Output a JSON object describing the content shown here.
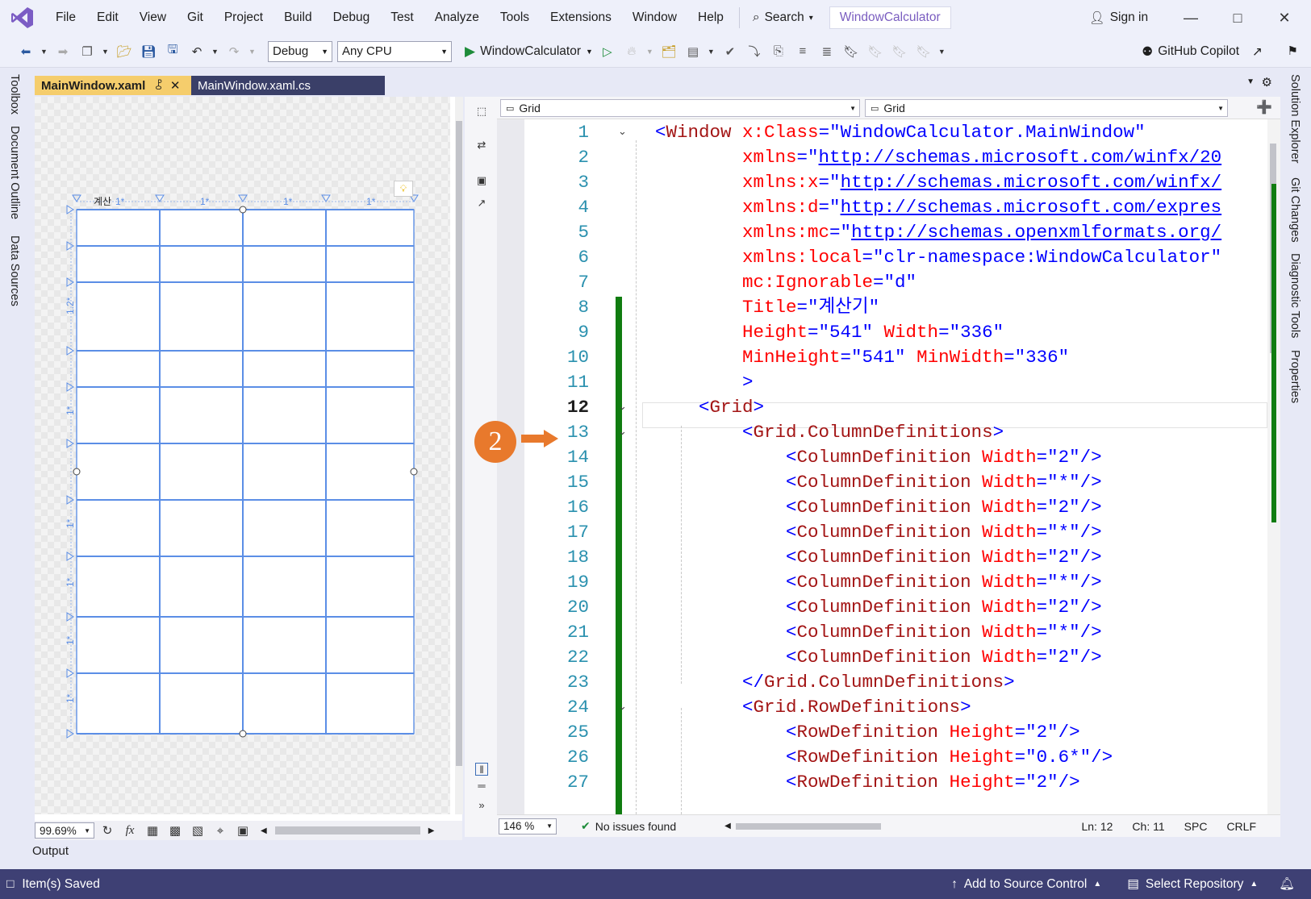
{
  "titlebar": {
    "menu": [
      "File",
      "Edit",
      "View",
      "Git",
      "Project",
      "Build",
      "Debug",
      "Test",
      "Analyze",
      "Tools",
      "Extensions",
      "Window",
      "Help"
    ],
    "search_label": "Search",
    "solution_name": "WindowCalculator",
    "signin_label": "Sign in"
  },
  "toolbar": {
    "config": "Debug",
    "platform": "Any CPU",
    "run_label": "WindowCalculator",
    "copilot_label": "GitHub Copilot"
  },
  "left_rail": [
    "Toolbox",
    "Document Outline",
    "Data Sources"
  ],
  "right_rail": [
    "Solution Explorer",
    "Git Changes",
    "Diagnostic Tools",
    "Properties"
  ],
  "tabs": [
    {
      "label": "MainWindow.xaml",
      "active": true
    },
    {
      "label": "MainWindow.xaml.cs",
      "active": false
    }
  ],
  "designer": {
    "title_fragment": "계산",
    "col_labels": [
      "1*",
      "1*",
      "1*",
      "1*"
    ],
    "row_labels": [
      "1.2*",
      "1*",
      "1*",
      "1*",
      "1*",
      "1*"
    ],
    "zoom": "99.69%"
  },
  "editor": {
    "nav_left": "Grid",
    "nav_right": "Grid",
    "zoom": "146 %",
    "issues": "No issues found",
    "line": "Ln: 12",
    "col": "Ch: 11",
    "spc": "SPC",
    "eol": "CRLF",
    "lines": [
      {
        "n": "1",
        "fold": true,
        "segs": [
          [
            "b",
            "<"
          ],
          [
            "t",
            "Window"
          ],
          [
            "a",
            " x:Class"
          ],
          [
            "b",
            "=\""
          ],
          [
            "b",
            "WindowCalculator.MainWindow"
          ],
          [
            "b",
            "\""
          ]
        ]
      },
      {
        "n": "2",
        "segs": [
          [
            "a",
            "        xmlns"
          ],
          [
            "b",
            "=\""
          ],
          [
            "u",
            "http://schemas.microsoft.com/winfx/20"
          ]
        ]
      },
      {
        "n": "3",
        "segs": [
          [
            "a",
            "        xmlns:x"
          ],
          [
            "b",
            "=\""
          ],
          [
            "u",
            "http://schemas.microsoft.com/winfx/"
          ]
        ]
      },
      {
        "n": "4",
        "segs": [
          [
            "a",
            "        xmlns:d"
          ],
          [
            "b",
            "=\""
          ],
          [
            "u",
            "http://schemas.microsoft.com/expres"
          ]
        ]
      },
      {
        "n": "5",
        "segs": [
          [
            "a",
            "        xmlns:mc"
          ],
          [
            "b",
            "=\""
          ],
          [
            "u",
            "http://schemas.openxmlformats.org/"
          ]
        ]
      },
      {
        "n": "6",
        "segs": [
          [
            "a",
            "        xmlns:local"
          ],
          [
            "b",
            "=\"clr-namespace:WindowCalculator\""
          ]
        ]
      },
      {
        "n": "7",
        "segs": [
          [
            "a",
            "        mc:Ignorable"
          ],
          [
            "b",
            "=\"d\""
          ]
        ]
      },
      {
        "n": "8",
        "segs": [
          [
            "a",
            "        Title"
          ],
          [
            "b",
            "=\"계산기\""
          ]
        ]
      },
      {
        "n": "9",
        "segs": [
          [
            "a",
            "        Height"
          ],
          [
            "b",
            "=\"541\""
          ],
          [
            "a",
            " Width"
          ],
          [
            "b",
            "=\"336\""
          ]
        ]
      },
      {
        "n": "10",
        "segs": [
          [
            "a",
            "        MinHeight"
          ],
          [
            "b",
            "=\"541\""
          ],
          [
            "a",
            " MinWidth"
          ],
          [
            "b",
            "=\"336\""
          ]
        ]
      },
      {
        "n": "11",
        "segs": [
          [
            "b",
            "        >"
          ]
        ]
      },
      {
        "n": "12",
        "fold": true,
        "cur": true,
        "segs": [
          [
            "b",
            "    <"
          ],
          [
            "t",
            "Grid"
          ],
          [
            "b",
            ">"
          ]
        ]
      },
      {
        "n": "13",
        "fold": true,
        "segs": [
          [
            "b",
            "        <"
          ],
          [
            "t",
            "Grid.ColumnDefinitions"
          ],
          [
            "b",
            ">"
          ]
        ]
      },
      {
        "n": "14",
        "segs": [
          [
            "b",
            "            <"
          ],
          [
            "t",
            "ColumnDefinition"
          ],
          [
            "a",
            " Width"
          ],
          [
            "b",
            "=\"2\"/>"
          ]
        ]
      },
      {
        "n": "15",
        "segs": [
          [
            "b",
            "            <"
          ],
          [
            "t",
            "ColumnDefinition"
          ],
          [
            "a",
            " Width"
          ],
          [
            "b",
            "=\"*\"/>"
          ]
        ]
      },
      {
        "n": "16",
        "segs": [
          [
            "b",
            "            <"
          ],
          [
            "t",
            "ColumnDefinition"
          ],
          [
            "a",
            " Width"
          ],
          [
            "b",
            "=\"2\"/>"
          ]
        ]
      },
      {
        "n": "17",
        "segs": [
          [
            "b",
            "            <"
          ],
          [
            "t",
            "ColumnDefinition"
          ],
          [
            "a",
            " Width"
          ],
          [
            "b",
            "=\"*\"/>"
          ]
        ]
      },
      {
        "n": "18",
        "segs": [
          [
            "b",
            "            <"
          ],
          [
            "t",
            "ColumnDefinition"
          ],
          [
            "a",
            " Width"
          ],
          [
            "b",
            "=\"2\"/>"
          ]
        ]
      },
      {
        "n": "19",
        "segs": [
          [
            "b",
            "            <"
          ],
          [
            "t",
            "ColumnDefinition"
          ],
          [
            "a",
            " Width"
          ],
          [
            "b",
            "=\"*\"/>"
          ]
        ]
      },
      {
        "n": "20",
        "segs": [
          [
            "b",
            "            <"
          ],
          [
            "t",
            "ColumnDefinition"
          ],
          [
            "a",
            " Width"
          ],
          [
            "b",
            "=\"2\"/>"
          ]
        ]
      },
      {
        "n": "21",
        "segs": [
          [
            "b",
            "            <"
          ],
          [
            "t",
            "ColumnDefinition"
          ],
          [
            "a",
            " Width"
          ],
          [
            "b",
            "=\"*\"/>"
          ]
        ]
      },
      {
        "n": "22",
        "segs": [
          [
            "b",
            "            <"
          ],
          [
            "t",
            "ColumnDefinition"
          ],
          [
            "a",
            " Width"
          ],
          [
            "b",
            "=\"2\"/>"
          ]
        ]
      },
      {
        "n": "23",
        "segs": [
          [
            "b",
            "        </"
          ],
          [
            "t",
            "Grid.ColumnDefinitions"
          ],
          [
            "b",
            ">"
          ]
        ]
      },
      {
        "n": "24",
        "fold": true,
        "segs": [
          [
            "b",
            "        <"
          ],
          [
            "t",
            "Grid.RowDefinitions"
          ],
          [
            "b",
            ">"
          ]
        ]
      },
      {
        "n": "25",
        "segs": [
          [
            "b",
            "            <"
          ],
          [
            "t",
            "RowDefinition"
          ],
          [
            "a",
            " Height"
          ],
          [
            "b",
            "=\"2\"/>"
          ]
        ]
      },
      {
        "n": "26",
        "segs": [
          [
            "b",
            "            <"
          ],
          [
            "t",
            "RowDefinition"
          ],
          [
            "a",
            " Height"
          ],
          [
            "b",
            "=\"0.6*\"/>"
          ]
        ]
      },
      {
        "n": "27",
        "segs": [
          [
            "b",
            "            <"
          ],
          [
            "t",
            "RowDefinition"
          ],
          [
            "a",
            " Height"
          ],
          [
            "b",
            "=\"2\"/>"
          ]
        ]
      }
    ]
  },
  "callout": {
    "number": "2"
  },
  "output_label": "Output",
  "statusbar": {
    "saved": "Item(s) Saved",
    "source_control": "Add to Source Control",
    "repo": "Select Repository"
  },
  "colors": {
    "accent": "#6b4fbb",
    "statusbar": "#3e4074",
    "tab_active": "#f5cd6c",
    "callout": "#e8792c",
    "change_bar": "#107c10"
  }
}
